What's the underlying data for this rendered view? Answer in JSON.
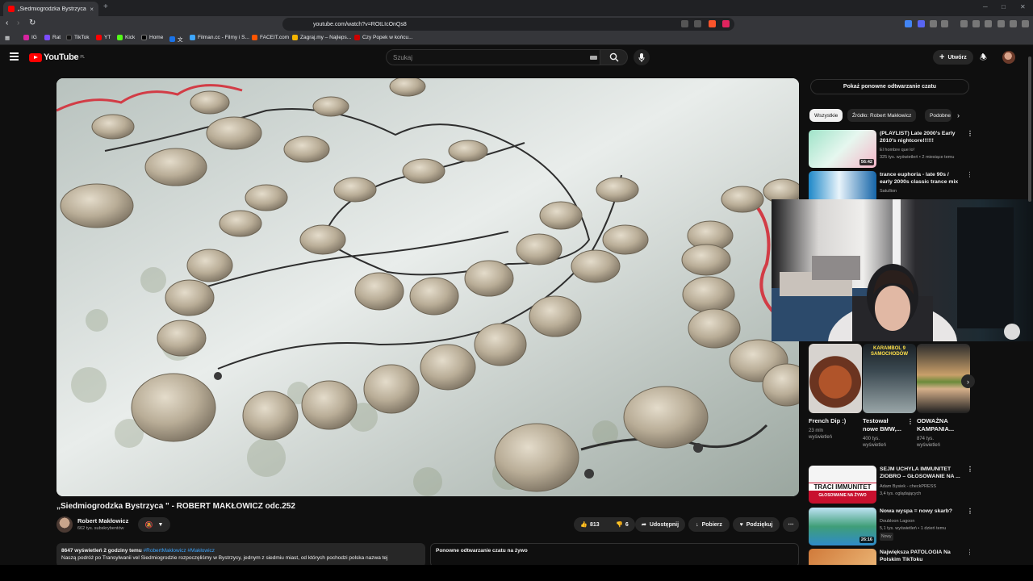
{
  "browser": {
    "tab_title": "„Siedmiogrodzka Bystrzyca \"",
    "tab_close": "×",
    "new_tab": "+",
    "url": "youtube.com/watch?v=ROtLIcOnQs8",
    "win_min": "─",
    "win_max": "□",
    "win_close": "✕"
  },
  "bookmarks": [
    {
      "label": "IG",
      "color": "#d6249f"
    },
    {
      "label": "Rat",
      "color": "#7c4dff"
    },
    {
      "label": "TikTok",
      "color": "#111111"
    },
    {
      "label": "YT",
      "color": "#ff0000"
    },
    {
      "label": "Kick",
      "color": "#53fc18"
    },
    {
      "label": "Home",
      "color": "#000000"
    },
    {
      "label": "文",
      "color": "#1a73e8"
    },
    {
      "label": "Filman.cc - Filmy i S...",
      "color": "#3ea6ff"
    },
    {
      "label": "FACEIT.com",
      "color": "#ff5500"
    },
    {
      "label": "Zagraj.my – Najleps...",
      "color": "#f4b400"
    },
    {
      "label": "Czy Popek w końcu...",
      "color": "#cc0000"
    }
  ],
  "header": {
    "logo_text": "YouTube",
    "logo_region": "PL",
    "search_placeholder": "Szukaj",
    "create_label": "Utwórz"
  },
  "video": {
    "title": "„Siedmiogrodzka Bystrzyca \" - ROBERT MAKŁOWICZ odc.252",
    "channel": "Robert Makłowicz",
    "subscribers": "662 tys. subskrybentów",
    "likes": "813",
    "dislikes": "6",
    "share": "Udostępnij",
    "download": "Pobierz",
    "thanks": "Podziękuj",
    "more": "⋯"
  },
  "description": {
    "meta": "8647 wyświetleń  2 godziny temu",
    "tags": "#RobertMakłowicz #Makłowicz",
    "text": "Naszą podróż po Transylwanii vel Siedmiogrodzie rozpoczęliśmy w Bystrzycy, jednym z siedmiu miast, od których pochodzi polska nazwa tej"
  },
  "chat_replay": {
    "title": "Ponowne odtwarzanie czatu na żywo",
    "button": "Pokaż ponowne odtwarzanie czatu"
  },
  "chips": [
    "Wszystkie",
    "Źródło: Robert Makłowicz",
    "Podobne"
  ],
  "recommendations_top": [
    {
      "title": "(PLAYLIST) Late 2000's Early 2010's nightcore!!!!!!",
      "channel": "El hombre que lo!",
      "meta": "325 tys. wyświetleń • 2 miesiące temu",
      "duration": "56:42"
    },
    {
      "title": "trance euphoria - late 90s / early 2000s classic trance mix",
      "channel": "Satullion",
      "meta": "",
      "duration": ""
    }
  ],
  "shorts": [
    {
      "title": "French Dip :)",
      "meta": "23 mln wyświetleń"
    },
    {
      "title": "Testował nowe BMW,...",
      "meta": "400 tys. wyświetleń"
    },
    {
      "title": "ODWAŻNA KAMPANIA...",
      "meta": "874 tys. wyświetleń"
    }
  ],
  "short_overlay": "KARAMBOL 9 SAMOCHODÓW",
  "recommendations_bottom": [
    {
      "title": "SEJM UCHYLA IMMUNITET ZIOBRO – GŁOSOWANIE NA ...",
      "channel": "Adam Bysiek - checkPRESS",
      "meta": "3,4 tys. oglądających",
      "thumb_text": "TRACI IMMUNITET",
      "thumb_sub": "GŁOSOWANIE NA ŻYWO"
    },
    {
      "title": "Nowa wyspa = nowy skarb?",
      "channel": "Doubloon Lagoon",
      "meta": "5,1 tys. wyświetleń • 1 dzień temu",
      "badge": "Nowy",
      "duration": "26:16"
    },
    {
      "title": "Największa PATOLOGIA Na Polskim TikToku",
      "channel": "",
      "meta": ""
    }
  ]
}
